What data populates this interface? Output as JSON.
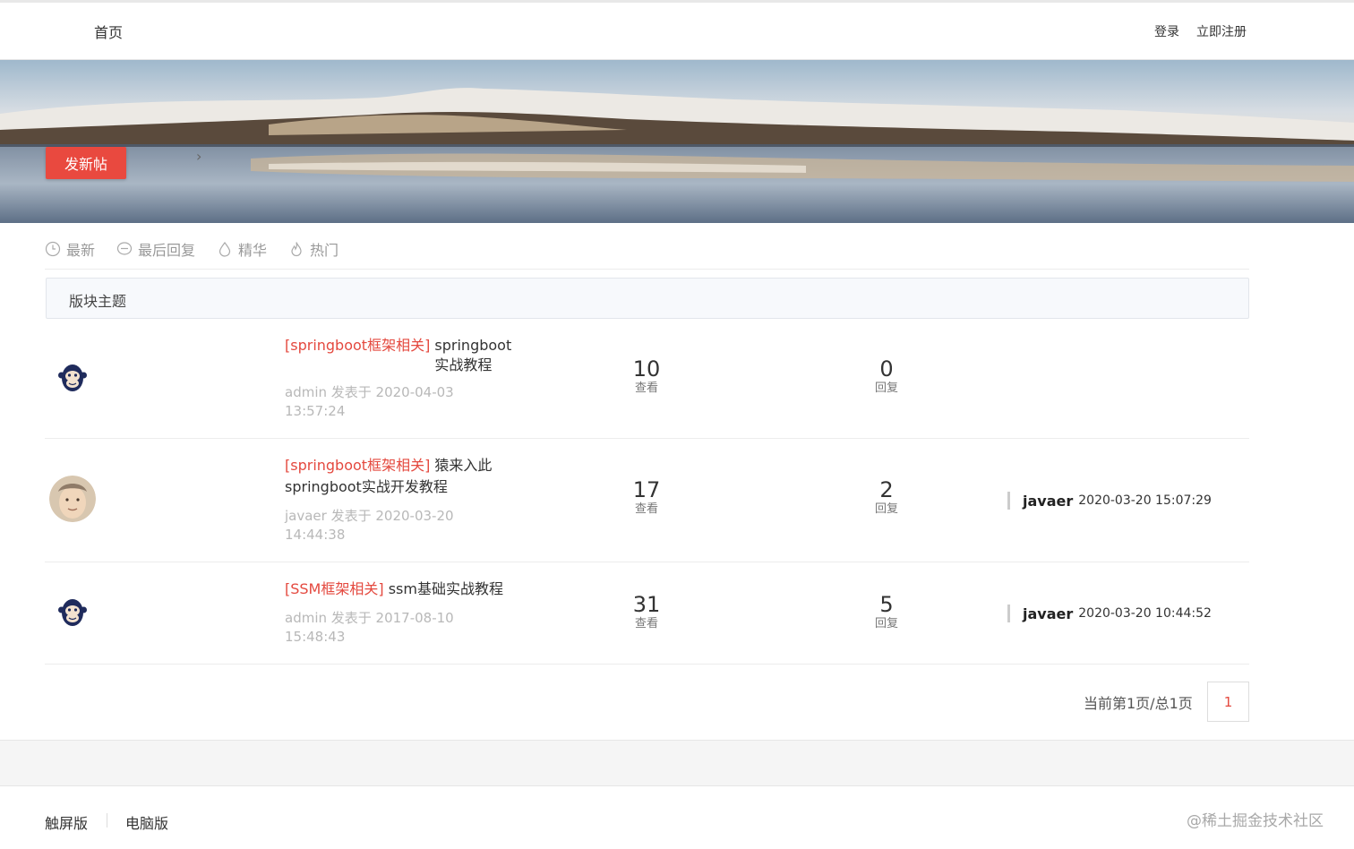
{
  "header": {
    "home": "首页",
    "login": "登录",
    "register": "立即注册"
  },
  "banner": {
    "breadcrumb_sep": [
      "›",
      "›"
    ],
    "new_post": "发新帖"
  },
  "filters": [
    {
      "icon": "clock-icon",
      "label": "最新"
    },
    {
      "icon": "chat-bubble-icon",
      "label": "最后回复"
    },
    {
      "icon": "drop-icon",
      "label": "精华"
    },
    {
      "icon": "flame-icon",
      "label": "热门"
    }
  ],
  "section": {
    "title": "版块主题"
  },
  "threads": [
    {
      "avatar": "monkey-avatar",
      "category": "[springboot框架相关]",
      "title_line1": "springboot",
      "title_line2": "实战教程",
      "author_line1": "admin 发表于 2020-04-03",
      "author_line2": "13:57:24",
      "views": "10",
      "views_label": "查看",
      "replies": "0",
      "replies_label": "回复"
    },
    {
      "avatar": "user-photo-avatar",
      "category": "[springboot框架相关]",
      "title_line1": "猿来入此",
      "title_line2": "springboot实战开发教程",
      "author_line1": "javaer 发表于 2020-03-20",
      "author_line2": "14:44:38",
      "views": "17",
      "views_label": "查看",
      "replies": "2",
      "replies_label": "回复",
      "last_user": "javaer",
      "last_time": "2020-03-20 15:07:29"
    },
    {
      "avatar": "monkey-avatar",
      "category": "[SSM框架相关]",
      "title_line1": "ssm基础实战教程",
      "author_line1": "admin 发表于 2017-08-10",
      "author_line2": "15:48:43",
      "views": "31",
      "views_label": "查看",
      "replies": "5",
      "replies_label": "回复",
      "last_user": "javaer",
      "last_time": "2020-03-20 10:44:52"
    }
  ],
  "pager": {
    "text": "当前第1页/总1页",
    "page": "1"
  },
  "footer": {
    "touch": "触屏版",
    "pc": "电脑版",
    "watermark": "@稀土掘金技术社区"
  },
  "colors": {
    "accent": "#e9493f",
    "category": "#e4493f"
  }
}
